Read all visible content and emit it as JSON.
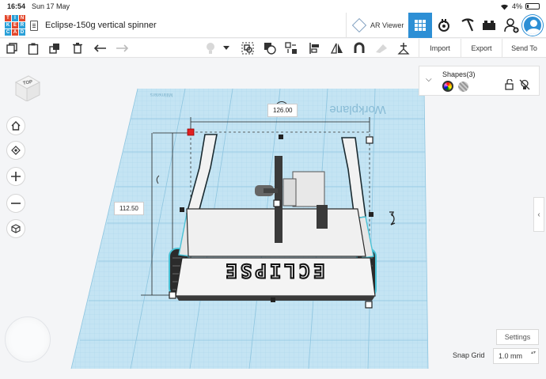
{
  "status_bar": {
    "time": "16:54",
    "date": "Sun 17 May",
    "battery": "4%"
  },
  "header": {
    "logo_letters": [
      "T",
      "I",
      "N",
      "K",
      "E",
      "R",
      "C",
      "A",
      "D"
    ],
    "title": "Eclipse-150g vertical spinner",
    "ar_viewer_label": "AR Viewer"
  },
  "toolbar": {
    "import_label": "Import",
    "export_label": "Export",
    "send_to_label": "Send To"
  },
  "workplane": {
    "label": "Workplane",
    "units_label": "Millimeters",
    "width_dim": "126.00",
    "depth_dim": "112.50",
    "model_text": "ECLIPSE"
  },
  "viewcube": {
    "face_label": "TOP"
  },
  "shapes_panel": {
    "title": "Shapes(3)"
  },
  "settings_label": "Settings",
  "snap_grid": {
    "label": "Snap Grid",
    "value": "1.0 mm"
  },
  "colors": {
    "accent": "#2d8fd5",
    "workplane": "#bfe0f0",
    "handle_red": "#e02020"
  }
}
